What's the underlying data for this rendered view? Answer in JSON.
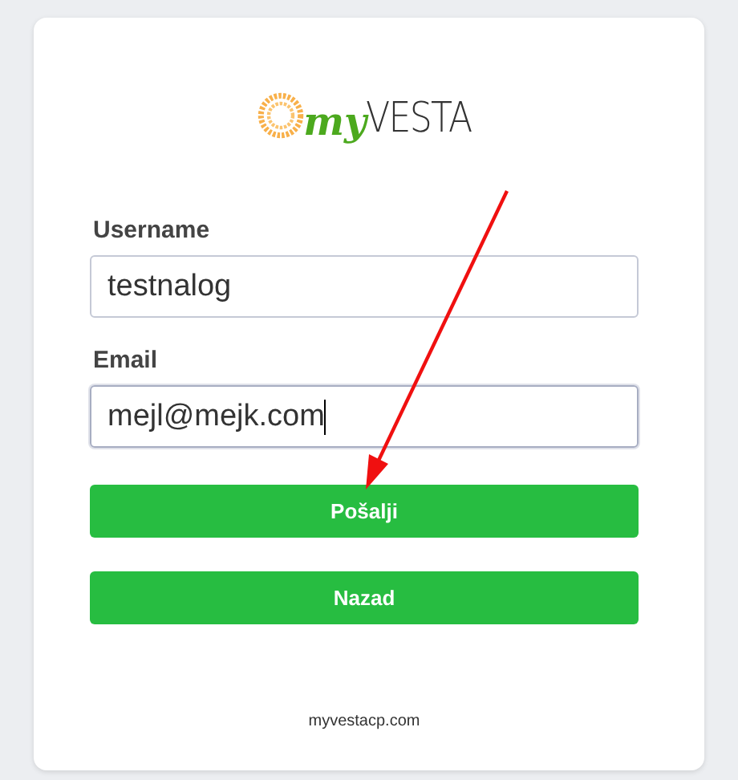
{
  "logo": {
    "prefix": "my",
    "name": "VESTA"
  },
  "fields": [
    {
      "label": "Username",
      "value": "testnalog",
      "focused": false
    },
    {
      "label": "Email",
      "value": "mejl@mejk.com",
      "focused": true
    }
  ],
  "buttons": [
    "Pošalji",
    "Nazad"
  ],
  "footer": "myvestacp.com"
}
